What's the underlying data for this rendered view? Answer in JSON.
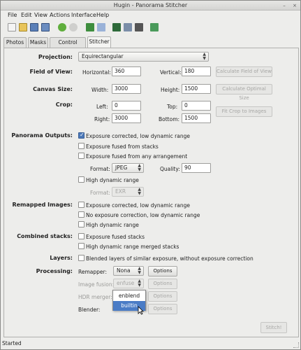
{
  "window": {
    "title": "Hugin - Panorama Stitcher",
    "minimize": "–",
    "close": "×"
  },
  "menu": [
    "File",
    "Edit",
    "View",
    "Actions",
    "Interface",
    "Help"
  ],
  "toolbar_icons": [
    "new-project-icon",
    "open-icon",
    "save-icon",
    "save-as-icon",
    "undo-icon",
    "redo-icon",
    "add-images-icon",
    "assistant-icon",
    "preview-icon",
    "control-points-icon",
    "layout-icon",
    "fast-preview-icon"
  ],
  "tabs": [
    "Photos",
    "Masks",
    "Control Points",
    "Stitcher"
  ],
  "active_tab": "Stitcher",
  "projection": {
    "label": "Projection:",
    "value": "Equirectangular"
  },
  "fov": {
    "label": "Field of View:",
    "horizontal_label": "Horizontal:",
    "horizontal": "360",
    "vertical_label": "Vertical:",
    "vertical": "180",
    "button": "Calculate Field of View"
  },
  "canvas": {
    "label": "Canvas Size:",
    "width_label": "Width:",
    "width": "3000",
    "height_label": "Height:",
    "height": "1500",
    "button": "Calculate Optimal Size"
  },
  "crop": {
    "label": "Crop:",
    "left_label": "Left:",
    "left": "0",
    "top_label": "Top:",
    "top": "0",
    "right_label": "Right:",
    "right": "3000",
    "bottom_label": "Bottom:",
    "bottom": "1500",
    "button": "Fit Crop to Images"
  },
  "outputs": {
    "label": "Panorama Outputs:",
    "opt1": "Exposure corrected, low dynamic range",
    "opt2": "Exposure fused from stacks",
    "opt3": "Exposure fused from any arrangement",
    "format_label": "Format:",
    "format": "JPEG",
    "quality_label": "Quality:",
    "quality": "90",
    "hdr": "High dynamic range",
    "hdr_format_label": "Format:",
    "hdr_format": "EXR"
  },
  "remapped": {
    "label": "Remapped Images:",
    "opt1": "Exposure corrected, low dynamic range",
    "opt2": "No exposure correction, low dynamic range",
    "opt3": "High dynamic range"
  },
  "combined": {
    "label": "Combined stacks:",
    "opt1": "Exposure fused stacks",
    "opt2": "High dynamic range merged stacks"
  },
  "layers": {
    "label": "Layers:",
    "opt1": "Blended layers of similar exposure, without exposure correction"
  },
  "processing": {
    "label": "Processing:",
    "remapper_label": "Remapper:",
    "remapper": "Nona",
    "fusion_label": "Image fusion:",
    "fusion": "enfuse",
    "hdr_label": "HDR merger:",
    "blender_label": "Blender:",
    "options": "Options"
  },
  "blender_popup": [
    "enblend",
    "builtin"
  ],
  "stitch_button": "Stitch!",
  "status": "Started"
}
